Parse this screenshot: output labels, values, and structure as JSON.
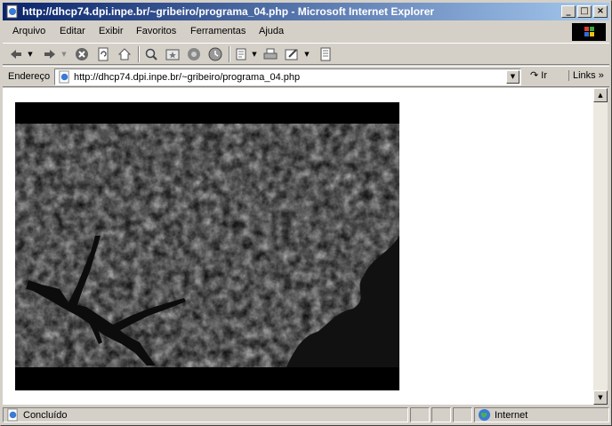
{
  "window": {
    "title": "http://dhcp74.dpi.inpe.br/~gribeiro/programa_04.php - Microsoft Internet Explorer",
    "minimize": "_",
    "maximize": "□",
    "close": "×"
  },
  "menu": {
    "items": [
      "Arquivo",
      "Editar",
      "Exibir",
      "Favoritos",
      "Ferramentas",
      "Ajuda"
    ]
  },
  "address": {
    "label": "Endereço",
    "url": "http://dhcp74.dpi.inpe.br/~gribeiro/programa_04.php",
    "go_label": "Ir",
    "links_label": "Links »"
  },
  "toolbar": {
    "icons": [
      "back-icon",
      "forward-icon",
      "stop-icon",
      "refresh-icon",
      "home-icon",
      "search-icon",
      "favorites-icon",
      "media-icon",
      "history-icon",
      "mail-icon",
      "print-icon",
      "edit-icon",
      "discuss-icon"
    ]
  },
  "status": {
    "text": "Concluído",
    "zone": "Internet"
  },
  "colors": {
    "title_start": "#0a246a",
    "title_end": "#a6caf0",
    "chrome": "#d4d0c8"
  }
}
